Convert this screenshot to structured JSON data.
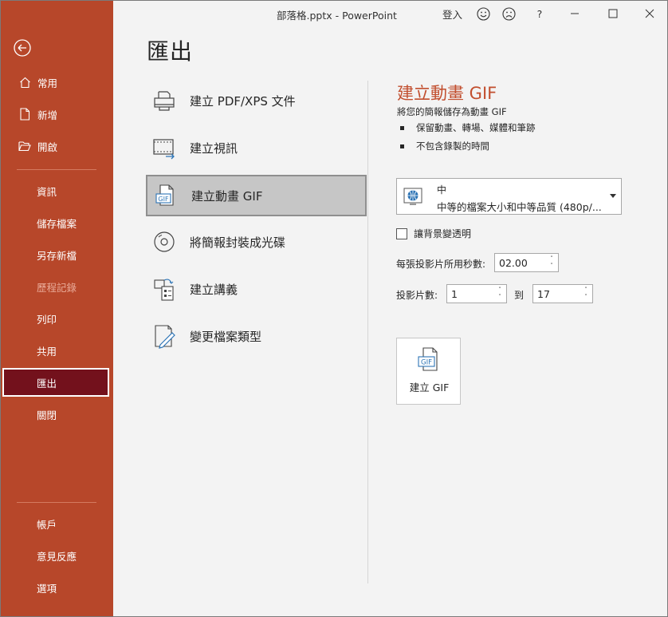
{
  "window": {
    "title": "部落格.pptx - PowerPoint",
    "sign_in": "登入",
    "help": "?"
  },
  "sidebar": {
    "top_items": [
      {
        "label": "常用",
        "icon": "home-icon"
      },
      {
        "label": "新增",
        "icon": "new-document-icon"
      },
      {
        "label": "開啟",
        "icon": "folder-open-icon"
      }
    ],
    "mid_items": [
      {
        "label": "資訊"
      },
      {
        "label": "儲存檔案"
      },
      {
        "label": "另存新檔"
      },
      {
        "label": "歷程記錄",
        "disabled": true
      },
      {
        "label": "列印"
      },
      {
        "label": "共用"
      },
      {
        "label": "匯出",
        "selected": true
      },
      {
        "label": "關閉"
      }
    ],
    "bottom_items": [
      {
        "label": "帳戶"
      },
      {
        "label": "意見反應"
      },
      {
        "label": "選項"
      }
    ]
  },
  "page_title": "匯出",
  "export_options": [
    {
      "label": "建立 PDF/XPS 文件",
      "icon": "pdf-printer-icon"
    },
    {
      "label": "建立視訊",
      "icon": "video-icon"
    },
    {
      "label": "建立動畫 GIF",
      "icon": "gif-icon",
      "selected": true
    },
    {
      "label": "將簡報封裝成光碟",
      "icon": "cd-icon"
    },
    {
      "label": "建立講義",
      "icon": "handout-icon"
    },
    {
      "label": "變更檔案類型",
      "icon": "change-file-type-icon"
    }
  ],
  "gif_panel": {
    "title": "建立動畫 GIF",
    "description": "將您的簡報儲存為動畫 GIF",
    "bullets": [
      "保留動畫、轉場、媒體和筆跡",
      "不包含錄製的時間"
    ],
    "quality": {
      "name": "中",
      "description": "中等的檔案大小和中等品質 (480p/..."
    },
    "transparent_label": "讓背景變透明",
    "transparent_checked": false,
    "seconds_label": "每張投影片所用秒數:",
    "seconds_value": "02.00",
    "slides_label": "投影片數:",
    "slides_from": "1",
    "to_label": "到",
    "slides_to": "17",
    "create_button_label": "建立 GIF",
    "create_button_icon_text": "GIF"
  },
  "colors": {
    "sidebar_bg": "#b7472a",
    "sidebar_selected_bg": "#73111c",
    "accent_title": "#c24f2f",
    "content_bg": "#f3f3f3"
  }
}
